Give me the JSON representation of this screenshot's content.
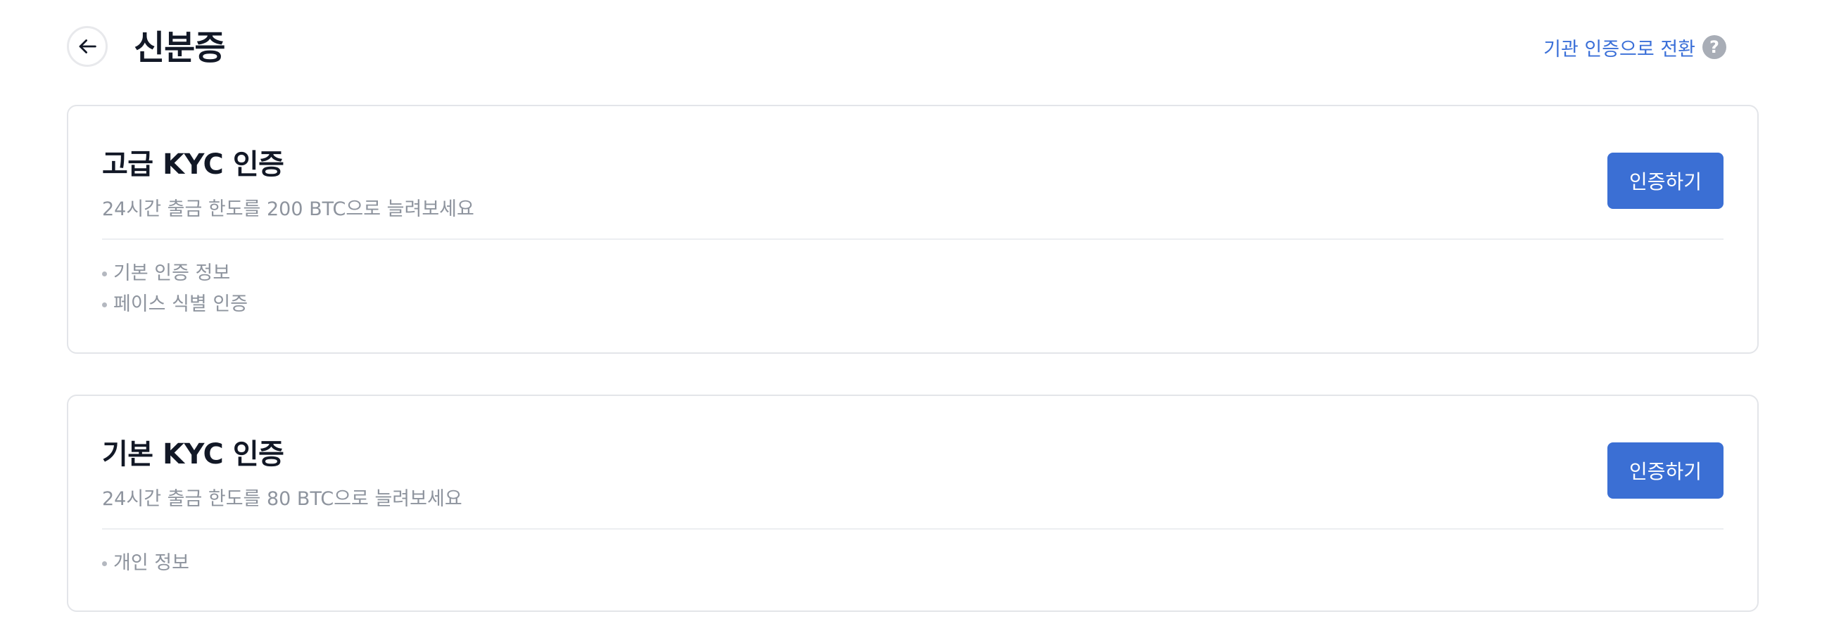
{
  "header": {
    "title": "신분증",
    "back_icon": "arrow-left-icon",
    "switch_label": "기관 인증으로 전환",
    "help_icon": "question-circle-icon",
    "help_glyph": "?"
  },
  "cards": [
    {
      "title": "고급 KYC 인증",
      "subtitle": "24시간 출금 한도를 200 BTC으로 늘려보세요",
      "button_label": "인증하기",
      "requirements": [
        "기본 인증 정보",
        "페이스 식별 인증"
      ]
    },
    {
      "title": "기본 KYC 인증",
      "subtitle": "24시간 출금 한도를 80 BTC으로 늘려보세요",
      "button_label": "인증하기",
      "requirements": [
        "개인 정보"
      ]
    }
  ],
  "colors": {
    "accent": "#3b6fd4",
    "link": "#3a6fd8",
    "muted_text": "#8e949e",
    "border": "#e3e5e9"
  }
}
